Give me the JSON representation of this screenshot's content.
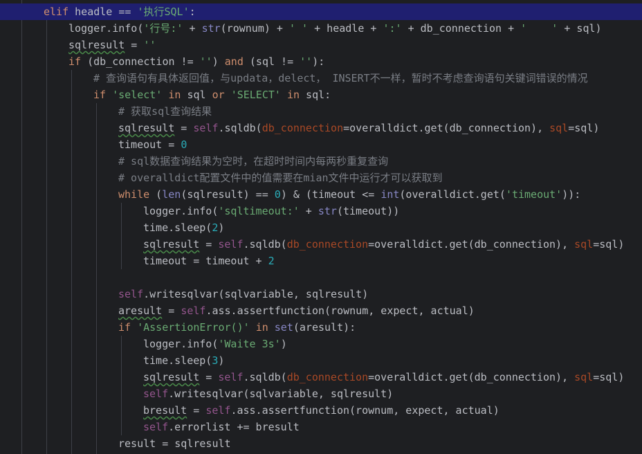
{
  "lines": [
    {
      "i": 1,
      "cur": true,
      "t": [
        [
          "elif",
          "kw"
        ],
        [
          " headle == ",
          ""
        ],
        [
          "'执行SQL'",
          "str"
        ],
        [
          ":",
          ""
        ]
      ]
    },
    {
      "i": 2,
      "t": [
        [
          "logger.info(",
          ""
        ],
        [
          "'行号:'",
          "str"
        ],
        [
          " + ",
          ""
        ],
        [
          "str",
          "bi"
        ],
        [
          "(rownum) + ",
          ""
        ],
        [
          "' '",
          "str"
        ],
        [
          " + headle + ",
          ""
        ],
        [
          "':'",
          "str"
        ],
        [
          " + db_connection + ",
          ""
        ],
        [
          "'    '",
          "str"
        ],
        [
          " + sql)",
          ""
        ]
      ]
    },
    {
      "i": 2,
      "t": [
        [
          "sqlresult",
          "sq"
        ],
        [
          " = ",
          ""
        ],
        [
          "''",
          "str"
        ]
      ]
    },
    {
      "i": 2,
      "t": [
        [
          "if",
          "kw"
        ],
        [
          " (db_connection != ",
          ""
        ],
        [
          "''",
          "str"
        ],
        [
          ") ",
          ""
        ],
        [
          "and",
          "kw"
        ],
        [
          " (sql != ",
          ""
        ],
        [
          "''",
          "str"
        ],
        [
          "):",
          ""
        ]
      ]
    },
    {
      "i": 3,
      "t": [
        [
          "# 查询语句有具体返回值，与updata，delect， INSERT不一样，暂时不考虑查询语句关键词错误的情况",
          "cm"
        ]
      ]
    },
    {
      "i": 3,
      "t": [
        [
          "if",
          "kw"
        ],
        [
          " ",
          ""
        ],
        [
          "'select'",
          "str"
        ],
        [
          " ",
          ""
        ],
        [
          "in",
          "kw"
        ],
        [
          " sql ",
          ""
        ],
        [
          "or",
          "kw"
        ],
        [
          " ",
          ""
        ],
        [
          "'SELECT'",
          "str"
        ],
        [
          " ",
          ""
        ],
        [
          "in",
          "kw"
        ],
        [
          " sql:",
          ""
        ]
      ]
    },
    {
      "i": 4,
      "t": [
        [
          "# 获取sql查询结果",
          "cm"
        ]
      ]
    },
    {
      "i": 4,
      "t": [
        [
          "sqlresult",
          "sq"
        ],
        [
          " = ",
          ""
        ],
        [
          "self",
          "slf"
        ],
        [
          ".sqldb(",
          ""
        ],
        [
          "db_connection",
          "prm"
        ],
        [
          "=overalldict.get(db_connection), ",
          ""
        ],
        [
          "sql",
          "prm"
        ],
        [
          "=sql)",
          ""
        ]
      ]
    },
    {
      "i": 4,
      "t": [
        [
          "timeout = ",
          ""
        ],
        [
          "0",
          "num"
        ]
      ]
    },
    {
      "i": 4,
      "t": [
        [
          "# sql数据查询结果为空时，在超时时间内每两秒重复查询",
          "cm"
        ]
      ]
    },
    {
      "i": 4,
      "t": [
        [
          "# overalldict配置文件中的值需要在mian文件中运行才可以获取到",
          "cm"
        ]
      ]
    },
    {
      "i": 4,
      "t": [
        [
          "while",
          "kw"
        ],
        [
          " (",
          ""
        ],
        [
          "len",
          "bi"
        ],
        [
          "(sqlresult) == ",
          ""
        ],
        [
          "0",
          "num"
        ],
        [
          ") & (timeout <= ",
          ""
        ],
        [
          "int",
          "bi"
        ],
        [
          "(overalldict.get(",
          ""
        ],
        [
          "'timeout'",
          "str"
        ],
        [
          ")):",
          ""
        ]
      ]
    },
    {
      "i": 5,
      "t": [
        [
          "logger.info(",
          ""
        ],
        [
          "'sqltimeout:'",
          "str"
        ],
        [
          " + ",
          ""
        ],
        [
          "str",
          "bi"
        ],
        [
          "(timeout))",
          ""
        ]
      ]
    },
    {
      "i": 5,
      "t": [
        [
          "time.sleep(",
          ""
        ],
        [
          "2",
          "num"
        ],
        [
          ")",
          ""
        ]
      ]
    },
    {
      "i": 5,
      "t": [
        [
          "sqlresult",
          "sq"
        ],
        [
          " = ",
          ""
        ],
        [
          "self",
          "slf"
        ],
        [
          ".sqldb(",
          ""
        ],
        [
          "db_connection",
          "prm"
        ],
        [
          "=overalldict.get(db_connection), ",
          ""
        ],
        [
          "sql",
          "prm"
        ],
        [
          "=sql)",
          ""
        ]
      ]
    },
    {
      "i": 5,
      "t": [
        [
          "timeout = timeout + ",
          ""
        ],
        [
          "2",
          "num"
        ]
      ]
    },
    {
      "i": 4,
      "t": []
    },
    {
      "i": 4,
      "t": [
        [
          "self",
          "slf"
        ],
        [
          ".writesqlvar(sqlvariable, sqlresult)",
          ""
        ]
      ]
    },
    {
      "i": 4,
      "t": [
        [
          "aresult",
          "sq"
        ],
        [
          " = ",
          ""
        ],
        [
          "self",
          "slf"
        ],
        [
          ".ass.assertfunction(rownum, expect, actual)",
          ""
        ]
      ]
    },
    {
      "i": 4,
      "t": [
        [
          "if",
          "kw"
        ],
        [
          " ",
          ""
        ],
        [
          "'AssertionError()'",
          "str"
        ],
        [
          " ",
          ""
        ],
        [
          "in",
          "kw"
        ],
        [
          " ",
          ""
        ],
        [
          "set",
          "bi"
        ],
        [
          "(aresult):",
          ""
        ]
      ]
    },
    {
      "i": 5,
      "t": [
        [
          "logger.info(",
          ""
        ],
        [
          "'Waite 3s'",
          "str"
        ],
        [
          ")",
          ""
        ]
      ]
    },
    {
      "i": 5,
      "t": [
        [
          "time.sleep(",
          ""
        ],
        [
          "3",
          "num"
        ],
        [
          ")",
          ""
        ]
      ]
    },
    {
      "i": 5,
      "t": [
        [
          "sqlresult",
          "sq"
        ],
        [
          " = ",
          ""
        ],
        [
          "self",
          "slf"
        ],
        [
          ".sqldb(",
          ""
        ],
        [
          "db_connection",
          "prm"
        ],
        [
          "=overalldict.get(db_connection), ",
          ""
        ],
        [
          "sql",
          "prm"
        ],
        [
          "=sql)",
          ""
        ]
      ]
    },
    {
      "i": 5,
      "t": [
        [
          "self",
          "slf"
        ],
        [
          ".writesqlvar(sqlvariable, sqlresult)",
          ""
        ]
      ]
    },
    {
      "i": 5,
      "t": [
        [
          "bresult",
          "sq"
        ],
        [
          " = ",
          ""
        ],
        [
          "self",
          "slf"
        ],
        [
          ".ass.assertfunction(rownum, expect, actual)",
          ""
        ]
      ]
    },
    {
      "i": 5,
      "t": [
        [
          "self",
          "slf"
        ],
        [
          ".errorlist += bresult",
          ""
        ]
      ]
    },
    {
      "i": 4,
      "t": [
        [
          "result = sqlresult",
          ""
        ]
      ]
    }
  ],
  "colors": {
    "background": "#1e1f22",
    "current_line": "#1f1f70",
    "keyword": "#cf8e6d",
    "string": "#6aab73",
    "number": "#2aacb8",
    "comment": "#7a7e85",
    "self": "#94558d",
    "builtin": "#8888c6",
    "param": "#aa4926",
    "text": "#bcbec4"
  }
}
